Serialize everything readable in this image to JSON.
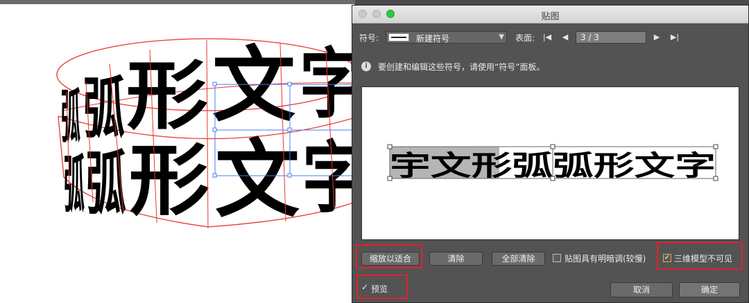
{
  "canvas": {
    "art_rows": [
      [
        "弧",
        "形",
        "文",
        "字"
      ],
      [
        "弧",
        "形",
        "文",
        "字"
      ]
    ]
  },
  "dialog": {
    "title": "贴图",
    "symbol_label": "符号:",
    "symbol_name": "新建符号",
    "surface_label": "表面:",
    "surface_value": "3 / 3",
    "info_text": "要创建和编辑这些符号，请使用“符号”面板。",
    "preview_text": "宇文形弧弧形文字",
    "buttons": {
      "fit": "缩放以适合",
      "clear": "清除",
      "clear_all": "全部清除",
      "cancel": "取消",
      "ok": "确定"
    },
    "checkboxes": {
      "shading": {
        "label": "贴图具有明暗调(较慢)",
        "checked": false
      },
      "hide_3d": {
        "label": "三维模型不可见",
        "checked": true
      },
      "preview": {
        "label": "预览",
        "checked": true
      }
    },
    "icons": {
      "first": "first-page-icon",
      "prev": "prev-page-icon",
      "next": "next-page-icon",
      "last": "last-page-icon",
      "info": "info-icon"
    }
  },
  "colors": {
    "highlight": "#e3202a",
    "traffic_green": "#2fc840",
    "checkbox_accent": "#e0a640"
  }
}
